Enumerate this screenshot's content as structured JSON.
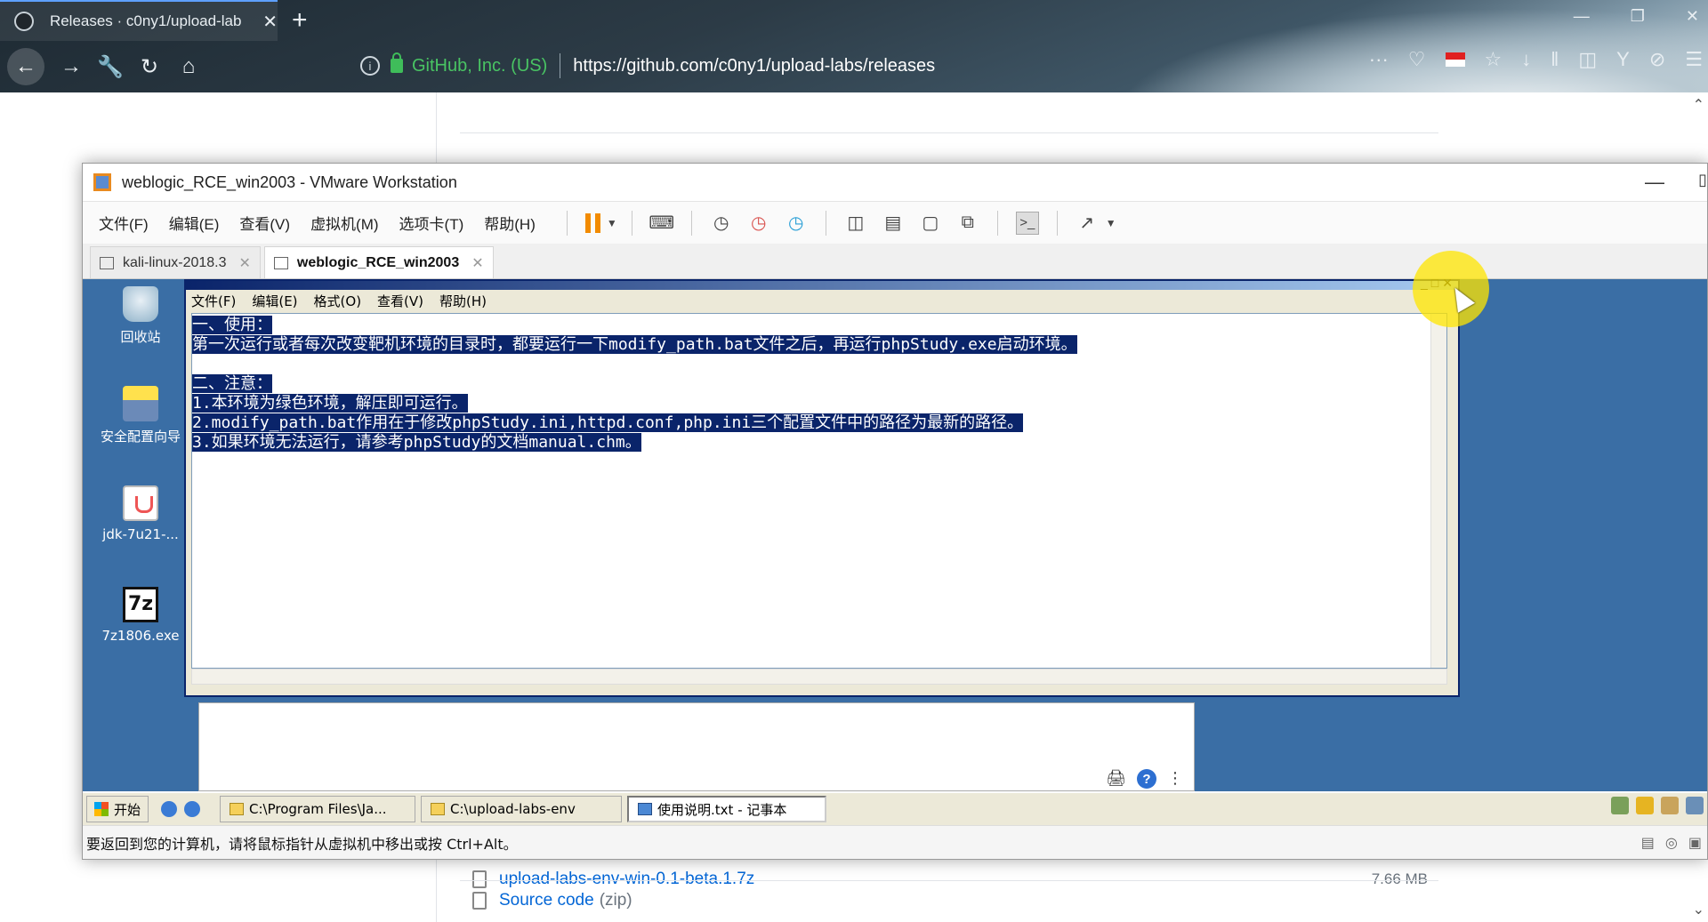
{
  "browser": {
    "tab_title": "Releases · c0ny1/upload-lab",
    "tab_close": "✕",
    "new_tab": "+",
    "url_org": "GitHub, Inc. (US)",
    "url": "https://github.com/c0ny1/upload-labs/releases",
    "more": "···"
  },
  "github": {
    "assets": [
      {
        "name": "upload-labs-env-win-0.1-beta.1.7z",
        "size": "7.66 MB"
      },
      {
        "name": "Source code",
        "ext": "(zip)"
      }
    ]
  },
  "vmware": {
    "title": "weblogic_RCE_win2003 - VMware Workstation",
    "menu": [
      "文件(F)",
      "编辑(E)",
      "查看(V)",
      "虚拟机(M)",
      "选项卡(T)",
      "帮助(H)"
    ],
    "tabs": [
      {
        "label": "kali-linux-2018.3",
        "active": false
      },
      {
        "label": "weblogic_RCE_win2003",
        "active": true
      }
    ],
    "status_text": "要返回到您的计算机，请将鼠标指针从虚拟机中移出或按 Ctrl+Alt。"
  },
  "guest": {
    "desktop_icons": [
      {
        "label": "回收站",
        "icon": "recycle-bin-icon"
      },
      {
        "label": "安全配置向导",
        "icon": "wizard-icon"
      },
      {
        "label": "jdk-7u21-...",
        "icon": "java-icon"
      },
      {
        "label": "7z1806.exe",
        "icon": "7zip-icon",
        "glyph": "7z"
      }
    ],
    "notepad": {
      "menu": [
        "文件(F)",
        "编辑(E)",
        "格式(O)",
        "查看(V)",
        "帮助(H)"
      ],
      "lines": [
        "一、使用：",
        "第一次运行或者每次改变靶机环境的目录时，都要运行一下modify_path.bat文件之后，再运行phpStudy.exe启动环境。",
        "",
        "二、注意：",
        "1.本环境为绿色环境，解压即可运行。",
        "2.modify_path.bat作用在于修改phpStudy.ini,httpd.conf,php.ini三个配置文件中的路径为最新的路径。",
        "3.如果环境无法运行，请参考phpStudy的文档manual.chm。"
      ]
    },
    "taskbar": {
      "start": "开始",
      "tasks": [
        {
          "label": "C:\\Program Files\\Ja...",
          "active": false
        },
        {
          "label": "C:\\upload-labs-env",
          "active": false
        },
        {
          "label": "使用说明.txt - 记事本",
          "active": true
        }
      ]
    },
    "help_glyph": "?"
  },
  "colors": {
    "selection": "#0a246a",
    "desktop": "#3a6ea5",
    "github_link": "#0366d6",
    "vmware_pause": "#f28b00"
  }
}
